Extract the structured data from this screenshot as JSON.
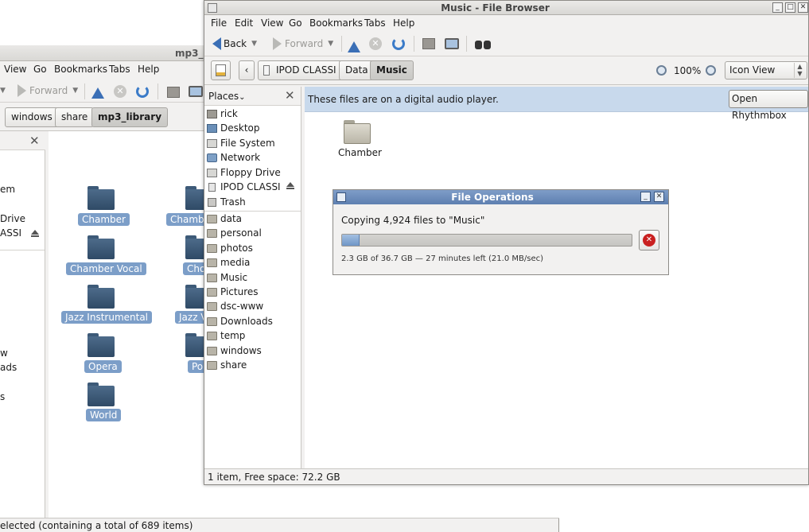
{
  "background_window": {
    "title": "mp3_l",
    "menu": [
      "View",
      "Go",
      "Bookmarks",
      "Tabs",
      "Help"
    ],
    "toolbar": {
      "forward_label": "Forward"
    },
    "path": [
      "windows",
      "share",
      "mp3_library"
    ],
    "sidebar_fragments": [
      "em",
      "Drive",
      "ASSI"
    ],
    "sidebar_fragments_lower": [
      "w",
      "ads",
      "s"
    ],
    "folders_col1": [
      "Chamber",
      "Chamber Vocal",
      "Jazz Instrumental",
      "Opera",
      "World"
    ],
    "folders_col2": [
      "Chambe",
      "Cho",
      "Jazz V",
      "Po"
    ],
    "status": "elected (containing a total of 689 items)"
  },
  "main_window": {
    "title": "Music - File Browser",
    "menu": [
      "File",
      "Edit",
      "View",
      "Go",
      "Bookmarks",
      "Tabs",
      "Help"
    ],
    "toolbar": {
      "back_label": "Back",
      "forward_label": "Forward"
    },
    "path": [
      "IPOD CLASSI",
      "Data",
      "Music"
    ],
    "zoom_level": "100%",
    "view_mode": "Icon View",
    "sidebar": {
      "header": "Places",
      "places": [
        {
          "label": "rick",
          "icon": "home-icon"
        },
        {
          "label": "Desktop",
          "icon": "desktop-icon"
        },
        {
          "label": "File System",
          "icon": "filesystem-icon"
        },
        {
          "label": "Network",
          "icon": "network-icon"
        },
        {
          "label": "Floppy Drive",
          "icon": "floppy-icon"
        },
        {
          "label": "IPOD CLASSI",
          "icon": "ipod-icon"
        },
        {
          "label": "Trash",
          "icon": "trash-icon"
        }
      ],
      "bookmarks": [
        "data",
        "personal",
        "photos",
        "media",
        "Music",
        "Pictures",
        "dsc-www",
        "Downloads",
        "temp",
        "windows",
        "share"
      ]
    },
    "info_bar": {
      "text": "These files are on a digital audio player.",
      "button_label": "Open Rhythmbox"
    },
    "folders": [
      "Chamber"
    ],
    "status": "1 item, Free space: 72.2 GB"
  },
  "file_operations": {
    "title": "File Operations",
    "progress_text": "Copying 4,924 files to \"Music\"",
    "progress_fraction": 0.06,
    "detail": "2.3 GB of 36.7 GB — 27 minutes left (21.0 MB/sec)"
  },
  "colors": {
    "selection": "#7c9ec8",
    "info_bar": "#c8d9ec",
    "dialog_title": "#6b8cbc",
    "accent_arrow": "#3b6fb6",
    "cancel_red": "#c92020"
  }
}
